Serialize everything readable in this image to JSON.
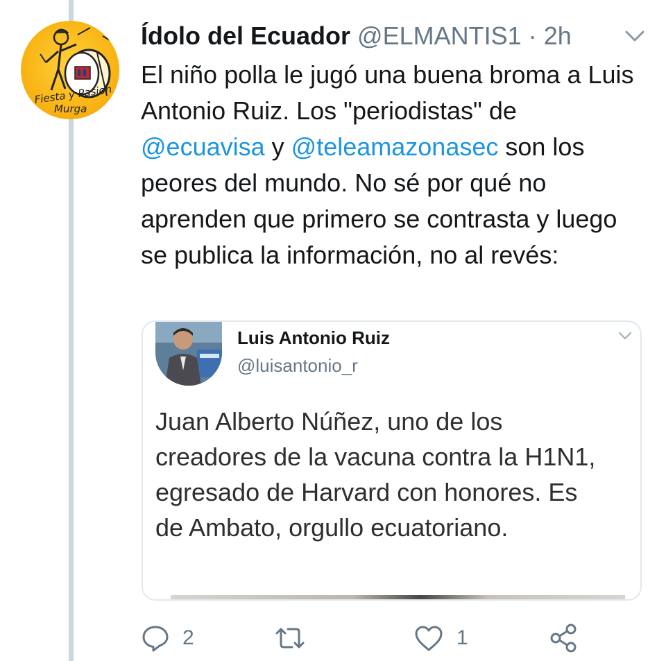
{
  "tweet": {
    "display_name": "Ídolo del Ecuador",
    "handle": "@ELMANTIS1",
    "separator": "·",
    "time": "2h",
    "text_parts": {
      "p1": "El niño polla le jugó una buena broma a Luis Antonio Ruiz. Los \"periodistas\" de ",
      "mention1": "@ecuavisa",
      "p2": " y ",
      "mention2": "@teleamazonasec",
      "p3": " son los peores del mundo. No sé por qué no aprenden que primero se contrasta y luego se publica la información, no al revés:"
    },
    "avatar_text": {
      "line1": "Fiesta y Pasion",
      "line2": "Murga"
    }
  },
  "quote": {
    "display_name": "Luis Antonio Ruiz",
    "handle": "@luisantonio_r",
    "text": "Juan Alberto Núñez, uno de los creadores de la vacuna contra la H1N1, egresado de Harvard con honores. Es de Ambato, orgullo ecuatoriano."
  },
  "actions": {
    "reply_count": "2",
    "retweet_count": "",
    "like_count": "1"
  },
  "colors": {
    "link": "#1b95e0",
    "secondary_text": "#657786",
    "thread_line": "#ccd6dd",
    "avatar_yellow": "#f9b516"
  },
  "icons": [
    "reply-icon",
    "retweet-icon",
    "like-icon",
    "share-icon",
    "chevron-down-icon"
  ]
}
